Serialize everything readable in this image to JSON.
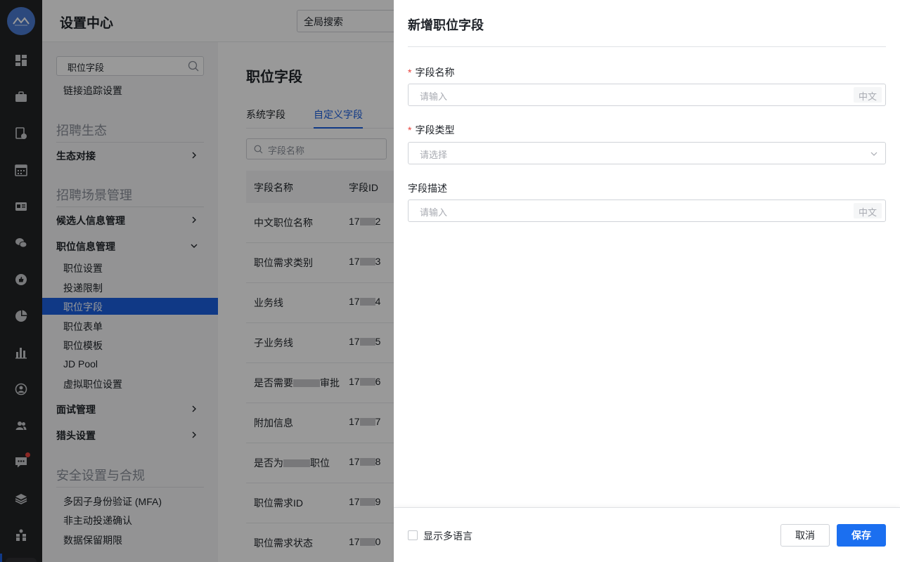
{
  "colors": {
    "accent": "#1b6ff0",
    "required": "#e8413c",
    "rail": "#222326"
  },
  "rail": {
    "icons": [
      "logo-icon",
      "dashboard-icon",
      "briefcase-icon",
      "resume-icon",
      "calendar-icon",
      "id-card-icon",
      "wechat-icon",
      "thumbs-up-icon",
      "pie-chart-icon",
      "bar-chart-icon",
      "person-circle-icon",
      "people-icon",
      "chat-icon",
      "layers-icon",
      "org-icon"
    ]
  },
  "topbar": {
    "title": "设置中心",
    "search_placeholder": "全局搜索"
  },
  "sidebar": {
    "search_value": "职位字段",
    "top_link": "链接追踪设置",
    "section_ecosystem": "招聘生态",
    "group_ecosystem": "生态对接",
    "section_scenarios": "招聘场景管理",
    "group_candidates": "候选人信息管理",
    "group_positions": "职位信息管理",
    "position_items": [
      "职位设置",
      "投递限制",
      "职位字段",
      "职位表单",
      "职位模板",
      "JD Pool",
      "虚拟职位设置"
    ],
    "group_interview": "面试管理",
    "group_headhunter": "猎头设置",
    "section_security": "安全设置与合规",
    "security_items": [
      "多因子身份验证 (MFA)",
      "非主动投递确认",
      "数据保留期限"
    ]
  },
  "main": {
    "title": "职位字段",
    "tabs": [
      "系统字段",
      "自定义字段"
    ],
    "search_placeholder": "字段名称",
    "columns": [
      "字段名称",
      "字段ID"
    ],
    "rows": [
      {
        "name_a": "中文职位名称",
        "name_b": "",
        "id_a": "17",
        "id_b": "2"
      },
      {
        "name_a": "职位需求类别",
        "name_b": "",
        "id_a": "17",
        "id_b": "3"
      },
      {
        "name_a": "业务线",
        "name_b": "",
        "id_a": "17",
        "id_b": "4"
      },
      {
        "name_a": "子业务线",
        "name_b": "",
        "id_a": "17",
        "id_b": "5"
      },
      {
        "name_a": "是否需要",
        "name_b": "审批",
        "id_a": "17",
        "id_b": "6"
      },
      {
        "name_a": "附加信息",
        "name_b": "",
        "id_a": "17",
        "id_b": "7"
      },
      {
        "name_a": "是否为",
        "name_b": "职位",
        "id_a": "17",
        "id_b": "8"
      },
      {
        "name_a": "职位需求ID",
        "name_b": "",
        "id_a": "17",
        "id_b": "9"
      },
      {
        "name_a": "职位需求状态",
        "name_b": "",
        "id_a": "17",
        "id_b": "0"
      }
    ]
  },
  "drawer": {
    "title": "新增职位字段",
    "fields": {
      "name_label": "字段名称",
      "name_placeholder": "请输入",
      "name_lang": "中文",
      "type_label": "字段类型",
      "type_placeholder": "请选择",
      "desc_label": "字段描述",
      "desc_placeholder": "请输入",
      "desc_lang": "中文",
      "required_mark": "*"
    },
    "footer": {
      "multilang_label": "显示多语言",
      "cancel": "取消",
      "save": "保存"
    }
  }
}
